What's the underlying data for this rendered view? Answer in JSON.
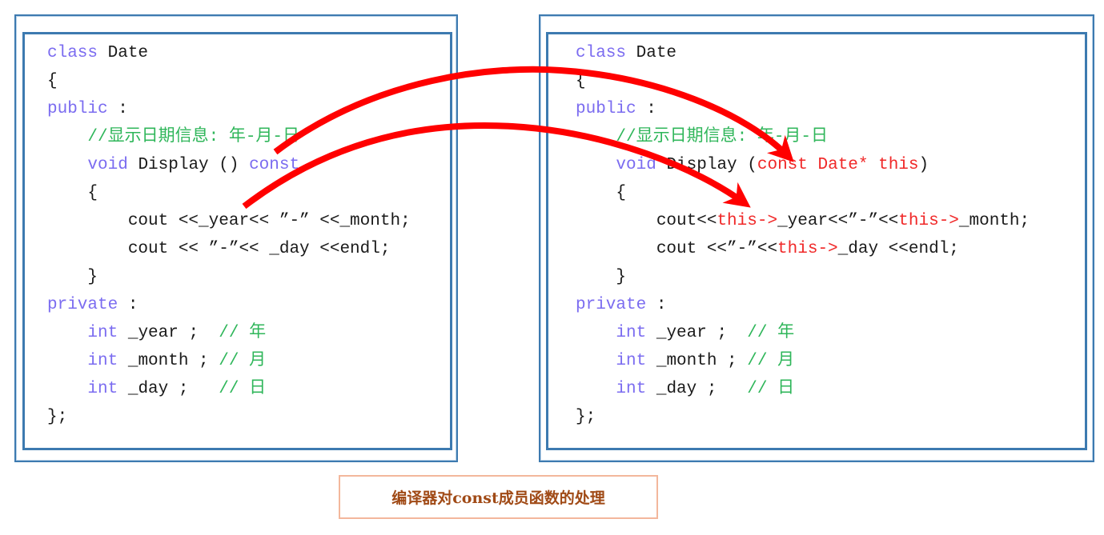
{
  "caption": "编译器对const成员函数的处理",
  "colors": {
    "frame": "#3d7ab0",
    "keyword": "#7b6cf0",
    "comment": "#2fb65a",
    "highlight": "#f02828",
    "arrow": "#ff0000",
    "caption_text": "#a04a16",
    "caption_border": "#f3b79c"
  },
  "left_panel": {
    "lines": [
      [
        {
          "t": "class",
          "c": "kw"
        },
        {
          "t": " Date",
          "c": "tx"
        }
      ],
      [
        {
          "t": "{",
          "c": "tx"
        }
      ],
      [
        {
          "t": "public",
          "c": "kw"
        },
        {
          "t": " :",
          "c": "tx"
        }
      ],
      [
        {
          "t": "    ",
          "c": "tx"
        },
        {
          "t": "//显示日期信息: 年-月-日",
          "c": "cm"
        }
      ],
      [
        {
          "t": "    ",
          "c": "tx"
        },
        {
          "t": "void",
          "c": "kw"
        },
        {
          "t": " Display () ",
          "c": "tx"
        },
        {
          "t": "const",
          "c": "kw"
        }
      ],
      [
        {
          "t": "    {",
          "c": "tx"
        }
      ],
      [
        {
          "t": "        cout <<_year<< ”-” <<_month;",
          "c": "tx"
        }
      ],
      [
        {
          "t": "        cout << ”-”<< _day <<endl;",
          "c": "tx"
        }
      ],
      [
        {
          "t": "    }",
          "c": "tx"
        }
      ],
      [
        {
          "t": "private",
          "c": "kw"
        },
        {
          "t": " :",
          "c": "tx"
        }
      ],
      [
        {
          "t": "    ",
          "c": "tx"
        },
        {
          "t": "int",
          "c": "kw"
        },
        {
          "t": " _year ;  ",
          "c": "tx"
        },
        {
          "t": "// 年",
          "c": "cm"
        }
      ],
      [
        {
          "t": "    ",
          "c": "tx"
        },
        {
          "t": "int",
          "c": "kw"
        },
        {
          "t": " _month ; ",
          "c": "tx"
        },
        {
          "t": "// 月",
          "c": "cm"
        }
      ],
      [
        {
          "t": "    ",
          "c": "tx"
        },
        {
          "t": "int",
          "c": "kw"
        },
        {
          "t": " _day ;   ",
          "c": "tx"
        },
        {
          "t": "// 日",
          "c": "cm"
        }
      ],
      [
        {
          "t": "};",
          "c": "tx"
        }
      ]
    ]
  },
  "right_panel": {
    "lines": [
      [
        {
          "t": "class",
          "c": "kw"
        },
        {
          "t": " Date",
          "c": "tx"
        }
      ],
      [
        {
          "t": "{",
          "c": "tx"
        }
      ],
      [
        {
          "t": "public",
          "c": "kw"
        },
        {
          "t": " :",
          "c": "tx"
        }
      ],
      [
        {
          "t": "    ",
          "c": "tx"
        },
        {
          "t": "//显示日期信息: 年-月-日",
          "c": "cm"
        }
      ],
      [
        {
          "t": "    ",
          "c": "tx"
        },
        {
          "t": "void",
          "c": "kw"
        },
        {
          "t": " Display (",
          "c": "tx"
        },
        {
          "t": "const Date* this",
          "c": "rd"
        },
        {
          "t": ")",
          "c": "tx"
        }
      ],
      [
        {
          "t": "    {",
          "c": "tx"
        }
      ],
      [
        {
          "t": "        cout<<",
          "c": "tx"
        },
        {
          "t": "this->",
          "c": "rd"
        },
        {
          "t": "_year<<”-”<<",
          "c": "tx"
        },
        {
          "t": "this->",
          "c": "rd"
        },
        {
          "t": "_month;",
          "c": "tx"
        }
      ],
      [
        {
          "t": "        cout <<”-”<<",
          "c": "tx"
        },
        {
          "t": "this->",
          "c": "rd"
        },
        {
          "t": "_day <<endl;",
          "c": "tx"
        }
      ],
      [
        {
          "t": "    }",
          "c": "tx"
        }
      ],
      [
        {
          "t": "private",
          "c": "kw"
        },
        {
          "t": " :",
          "c": "tx"
        }
      ],
      [
        {
          "t": "    ",
          "c": "tx"
        },
        {
          "t": "int",
          "c": "kw"
        },
        {
          "t": " _year ;  ",
          "c": "tx"
        },
        {
          "t": "// 年",
          "c": "cm"
        }
      ],
      [
        {
          "t": "    ",
          "c": "tx"
        },
        {
          "t": "int",
          "c": "kw"
        },
        {
          "t": " _month ; ",
          "c": "tx"
        },
        {
          "t": "// 月",
          "c": "cm"
        }
      ],
      [
        {
          "t": "    ",
          "c": "tx"
        },
        {
          "t": "int",
          "c": "kw"
        },
        {
          "t": " _day ;   ",
          "c": "tx"
        },
        {
          "t": "// 日",
          "c": "cm"
        }
      ],
      [
        {
          "t": "};",
          "c": "tx"
        }
      ]
    ]
  },
  "arrows": [
    {
      "from": "left-const-qualifier",
      "to": "right-const-this-parameter"
    },
    {
      "from": "left-member-access",
      "to": "right-this-member-access"
    }
  ]
}
